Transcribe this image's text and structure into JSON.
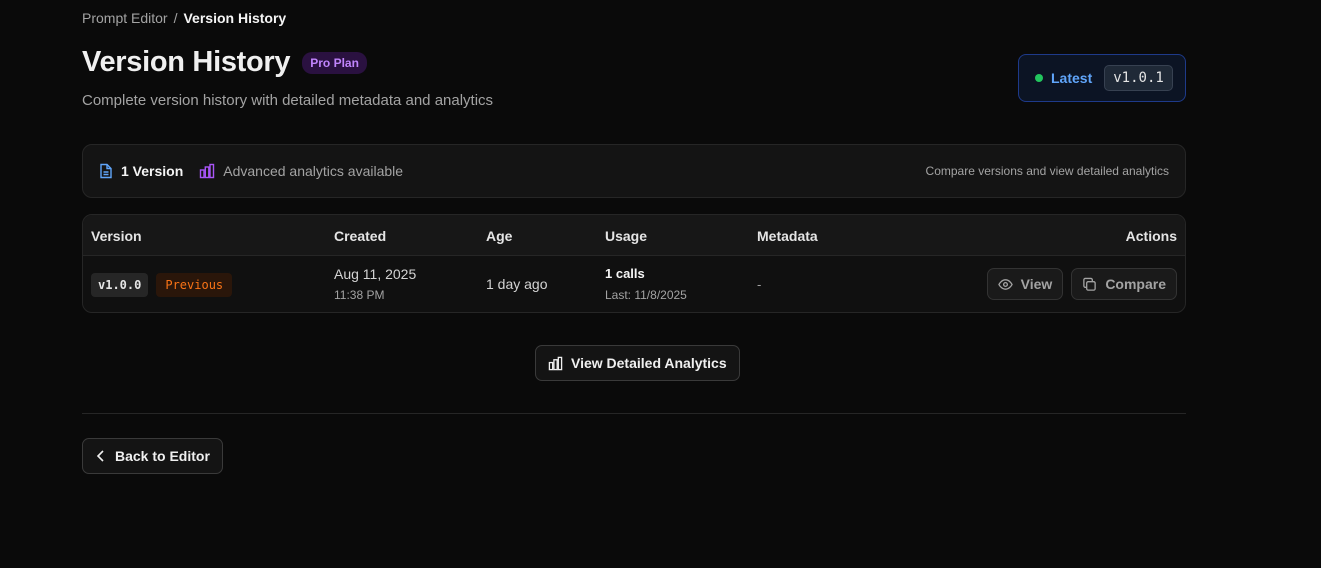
{
  "breadcrumb": {
    "parent": "Prompt Editor",
    "separator": "/",
    "current": "Version History"
  },
  "header": {
    "title": "Version History",
    "plan_badge": "Pro Plan",
    "subtitle": "Complete version history with detailed metadata and analytics"
  },
  "latest": {
    "label": "Latest",
    "version": "v1.0.1",
    "status_color": "#22c55e"
  },
  "summary": {
    "version_count": "1 Version",
    "analytics_text": "Advanced analytics available",
    "hint": "Compare versions and view detailed analytics"
  },
  "table": {
    "headers": {
      "version": "Version",
      "created": "Created",
      "age": "Age",
      "usage": "Usage",
      "metadata": "Metadata",
      "actions": "Actions"
    },
    "rows": [
      {
        "version": "v1.0.0",
        "tag": "Previous",
        "created_date": "Aug 11, 2025",
        "created_time": "11:38 PM",
        "age": "1 day ago",
        "calls": "1 calls",
        "last_used": "Last: 11/8/2025",
        "metadata": "-",
        "view_label": "View",
        "compare_label": "Compare"
      }
    ]
  },
  "actions": {
    "analytics_button": "View Detailed Analytics",
    "back_button": "Back to Editor"
  },
  "colors": {
    "accent_blue": "#60a5fa",
    "accent_purple": "#c084fc",
    "previous_orange": "#f97316"
  }
}
